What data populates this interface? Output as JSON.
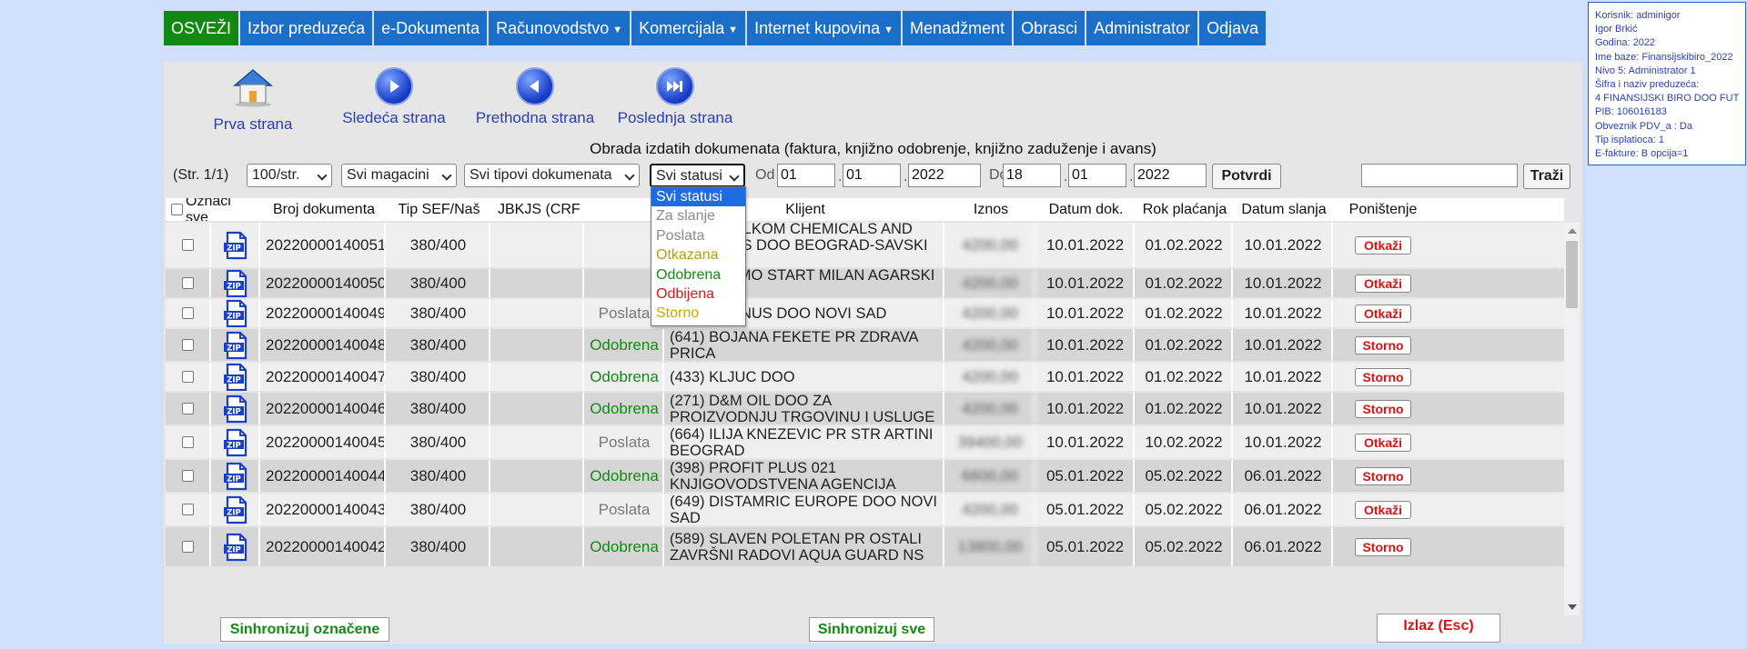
{
  "nav": [
    {
      "label": "OSVEŽI",
      "dropdown": false,
      "accent": "#118811"
    },
    {
      "label": "Izbor preduzeća",
      "dropdown": false
    },
    {
      "label": "e-Dokumenta",
      "dropdown": false
    },
    {
      "label": "Računovodstvo",
      "dropdown": true
    },
    {
      "label": "Komercijala",
      "dropdown": true
    },
    {
      "label": "Internet kupovina",
      "dropdown": true
    },
    {
      "label": "Menadžment",
      "dropdown": false
    },
    {
      "label": "Obrasci",
      "dropdown": false
    },
    {
      "label": "Administrator",
      "dropdown": false
    },
    {
      "label": "Odjava",
      "dropdown": false
    }
  ],
  "user_info": [
    "Korisnik: adminigor",
    "Igor Brkić",
    "Godina: 2022",
    "Ime baze: Finansijskibiro_2022",
    "Nivo 5: Administrator 1",
    "Šifra i naziv preduzeća:",
    "4 FINANSIJSKI BIRO DOO FUT",
    "PIB: 106016183",
    "Obveznik PDV_a : Da",
    "Tip isplatioca: 1",
    "E-fakture: B opcija=1"
  ],
  "pager": {
    "first": "Prva strana",
    "next": "Sledeća strana",
    "prev": "Prethodna strana",
    "last": "Poslednja strana"
  },
  "title": "Obrada izdatih dokumenata (faktura, knjižno odobrenje, knjižno zaduženje i avans)",
  "filters": {
    "page_info": "(Str. 1/1)",
    "per_page": "100/str.",
    "warehouse": "Svi magacini",
    "doc_type": "Svi tipovi dokumenata",
    "status": "Svi statusi",
    "from_label": "Od",
    "from_day": "01",
    "from_month": "01",
    "from_year": "2022",
    "to_label": "Do",
    "to_day": "18",
    "to_month": "01",
    "to_year": "2022",
    "confirm": "Potvrdi",
    "search_value": "",
    "search_button": "Traži"
  },
  "columns": {
    "select_all": "Označi sve",
    "doc_number": "Broj dokumenta",
    "type": "Tip SEF/Naš",
    "jbkjs": "JBKJS (CRF",
    "status_tail": "s",
    "client": "Klijent",
    "amount": "Iznos",
    "doc_date": "Datum dok.",
    "due_date": "Rok plaćanja",
    "sent_date": "Datum slanja",
    "cancel": "Poništenje"
  },
  "rows": [
    {
      "doc": "20220000140051",
      "type": "380/400",
      "status": "",
      "status_kind": "",
      "client": "(620) INTELKOM CHEMICALS AND POLYMERS DOO BEOGRAD-SAVSKI VENAC",
      "amount": "4200,00",
      "doc_date": "10.01.2022",
      "due": "01.02.2022",
      "sent": "10.01.2022",
      "action": "Otkaži"
    },
    {
      "doc": "20220000140050",
      "type": "380/400",
      "status": "",
      "status_kind": "",
      "client": "(347) TERMO START MILAN AGARSKI PR",
      "amount": "4200,00",
      "doc_date": "10.01.2022",
      "due": "01.02.2022",
      "sent": "10.01.2022",
      "action": "Otkaži"
    },
    {
      "doc": "20220000140049",
      "type": "380/400",
      "status": "Poslata",
      "status_kind": "poslata",
      "client": "(665) PRUNUS DOO NOVI SAD",
      "amount": "4200,00",
      "doc_date": "10.01.2022",
      "due": "01.02.2022",
      "sent": "10.01.2022",
      "action": "Otkaži"
    },
    {
      "doc": "20220000140048",
      "type": "380/400",
      "status": "Odobrena",
      "status_kind": "odobrena",
      "client": "(641) BOJANA FEKETE PR ZDRAVA PRICA",
      "amount": "4200,00",
      "doc_date": "10.01.2022",
      "due": "01.02.2022",
      "sent": "10.01.2022",
      "action": "Storno"
    },
    {
      "doc": "20220000140047",
      "type": "380/400",
      "status": "Odobrena",
      "status_kind": "odobrena",
      "client": "(433) KLJUC DOO",
      "amount": "4200,00",
      "doc_date": "10.01.2022",
      "due": "01.02.2022",
      "sent": "10.01.2022",
      "action": "Storno"
    },
    {
      "doc": "20220000140046",
      "type": "380/400",
      "status": "Odobrena",
      "status_kind": "odobrena",
      "client": "(271) D&M OIL DOO ZA PROIZVODNJU TRGOVINU I USLUGE",
      "amount": "4200,00",
      "doc_date": "10.01.2022",
      "due": "01.02.2022",
      "sent": "10.01.2022",
      "action": "Storno"
    },
    {
      "doc": "20220000140045",
      "type": "380/400",
      "status": "Poslata",
      "status_kind": "poslata",
      "client": "(664) ILIJA KNEZEVIC PR STR ARTINI BEOGRAD",
      "amount": "39400,00",
      "doc_date": "10.01.2022",
      "due": "10.02.2022",
      "sent": "10.01.2022",
      "action": "Otkaži"
    },
    {
      "doc": "20220000140044",
      "type": "380/400",
      "status": "Odobrena",
      "status_kind": "odobrena",
      "client": "(398) PROFIT PLUS 021 KNJIGOVODSTVENA AGENCIJA",
      "amount": "6600,00",
      "doc_date": "05.01.2022",
      "due": "05.02.2022",
      "sent": "06.01.2022",
      "action": "Storno"
    },
    {
      "doc": "20220000140043",
      "type": "380/400",
      "status": "Poslata",
      "status_kind": "poslata",
      "client": "(649) DISTAMRIC EUROPE DOO NOVI SAD",
      "amount": "4200,00",
      "doc_date": "05.01.2022",
      "due": "05.02.2022",
      "sent": "06.01.2022",
      "action": "Otkaži"
    },
    {
      "doc": "20220000140042",
      "type": "380/400",
      "status": "Odobrena",
      "status_kind": "odobrena",
      "client": "(589) SLAVEN POLETAN PR OSTALI ZAVRŠNI RADOVI AQUA GUARD NS",
      "amount": "13800,00",
      "doc_date": "05.01.2022",
      "due": "05.02.2022",
      "sent": "06.01.2022",
      "action": "Storno"
    }
  ],
  "status_options": [
    {
      "label": "Svi statusi",
      "color": "#ffffff",
      "selected": true
    },
    {
      "label": "Za slanje",
      "color": "#8a8a8a"
    },
    {
      "label": "Poslata",
      "color": "#8a8a8a"
    },
    {
      "label": "Otkazana",
      "color": "#b0a000"
    },
    {
      "label": "Odobrena",
      "color": "#138a13"
    },
    {
      "label": "Odbijena",
      "color": "#e0141e"
    },
    {
      "label": "Storno",
      "color": "#c9a600"
    }
  ],
  "footer": {
    "sync_selected": "Sinhronizuj označene",
    "sync_all": "Sinhronizuj sve",
    "exit": "Izlaz (Esc)"
  },
  "colors": {
    "nav_bg": "#1b6fc9",
    "refresh_bg": "#118811",
    "approved": "#138a13",
    "cancel": "#dd1111",
    "link": "#2a3fb5"
  }
}
